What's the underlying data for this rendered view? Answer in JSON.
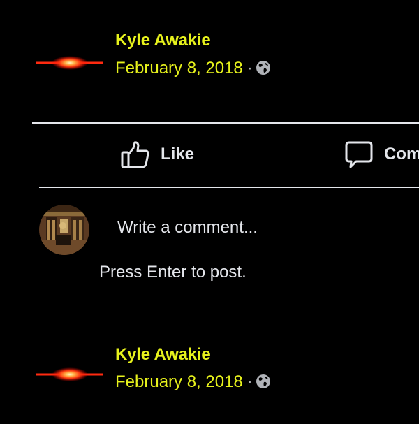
{
  "posts": [
    {
      "author": "Kyle Awakie",
      "date": "February 8, 2018",
      "separator": "·"
    },
    {
      "author": "Kyle Awakie",
      "date": "February 8, 2018",
      "separator": "·"
    }
  ],
  "actions": {
    "like_label": "Like",
    "comment_label": "Com"
  },
  "comment_box": {
    "placeholder": "Write a comment...",
    "hint": "Press Enter to post."
  },
  "icons": {
    "privacy": "globe-icon",
    "like": "thumbs-up-icon",
    "comment": "speech-bubble-icon"
  },
  "colors": {
    "author_text": "#e7f21c",
    "body_text": "#e4e6eb",
    "avatar_glow": "#ff3b10",
    "background": "#000000"
  }
}
